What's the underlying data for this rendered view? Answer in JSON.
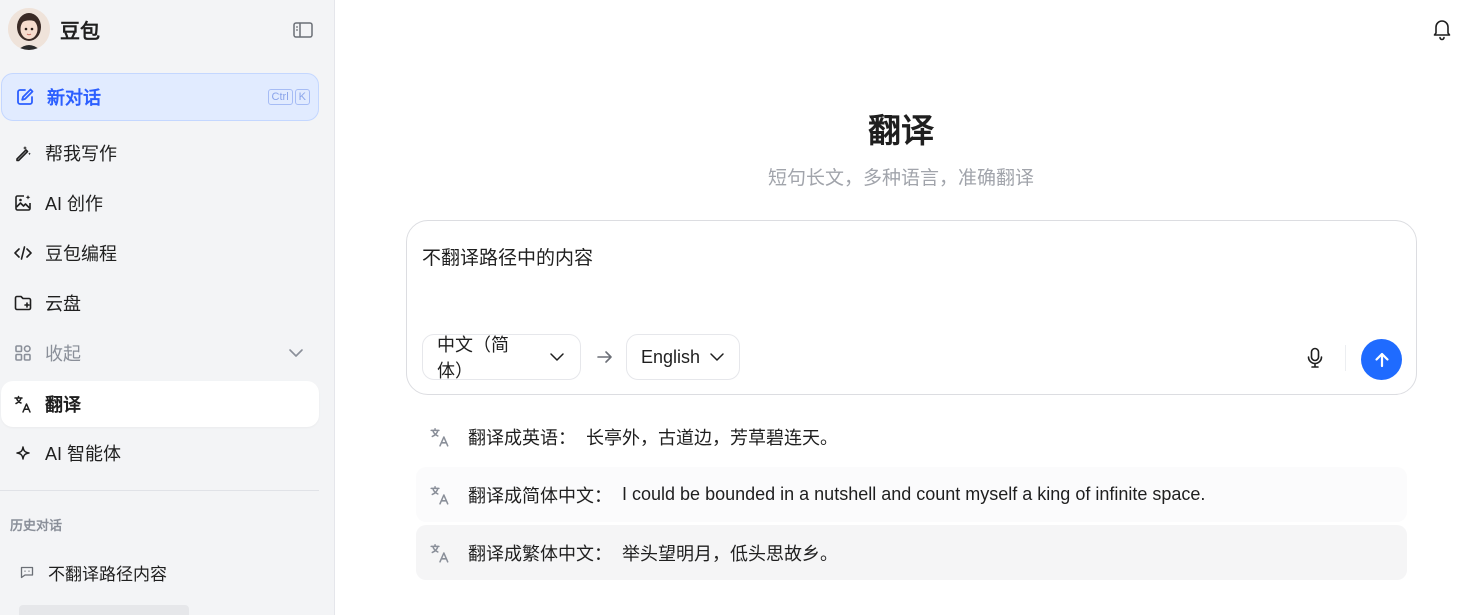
{
  "app": {
    "name": "豆包"
  },
  "sidebar": {
    "new_chat": {
      "label": "新对话",
      "shortcut": [
        "Ctrl",
        "K"
      ]
    },
    "items": [
      {
        "label": "帮我写作",
        "icon": "pen-sparkle-icon"
      },
      {
        "label": "AI 创作",
        "icon": "image-create-icon"
      },
      {
        "label": "豆包编程",
        "icon": "code-icon"
      },
      {
        "label": "云盘",
        "icon": "folder-icon"
      },
      {
        "label": "收起",
        "icon": "grid-icon"
      },
      {
        "label": "翻译",
        "icon": "translate-icon",
        "active": true
      },
      {
        "label": "AI 智能体",
        "icon": "sparkle-icon"
      }
    ],
    "history": {
      "header": "历史对话",
      "items": [
        {
          "label": "不翻译路径内容"
        }
      ]
    }
  },
  "main": {
    "title": "翻译",
    "subtitle": "短句长文，多种语言，准确翻译",
    "composer": {
      "text": "不翻译路径中的内容",
      "source_language": "中文（简体）",
      "target_language": "English"
    },
    "suggestions": [
      {
        "prefix": "翻译成英语：  ",
        "text": "长亭外，古道边，芳草碧连天。"
      },
      {
        "prefix": "翻译成简体中文：  ",
        "text": "I could be bounded in a nutshell and count myself a king of infinite space."
      },
      {
        "prefix": "翻译成繁体中文：  ",
        "text": "举头望明月，低头思故乡。"
      }
    ]
  },
  "colors": {
    "accent": "#1f6bff",
    "new_chat_bg": "#e1ebff",
    "new_chat_text": "#2c5fff",
    "sidebar_bg": "#f3f4f6"
  }
}
